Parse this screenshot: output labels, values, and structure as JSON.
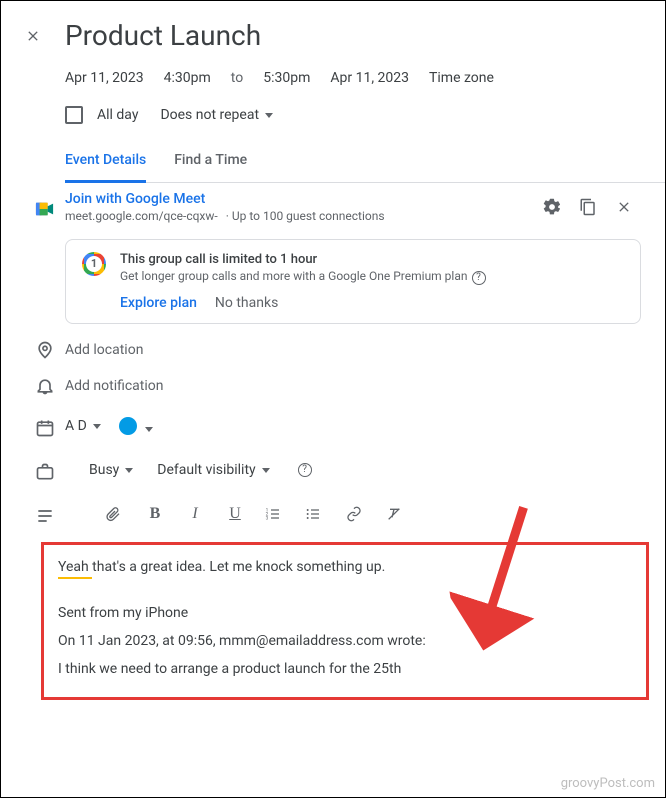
{
  "header": {
    "title": "Product Launch"
  },
  "datetime": {
    "start_date": "Apr 11, 2023",
    "start_time": "4:30pm",
    "to": "to",
    "end_time": "5:30pm",
    "end_date": "Apr 11, 2023",
    "timezone": "Time zone"
  },
  "all_day": {
    "label": "All day",
    "repeat": "Does not repeat"
  },
  "tabs": {
    "details": "Event Details",
    "find": "Find a Time"
  },
  "meet": {
    "title": "Join with Google Meet",
    "url": "meet.google.com/qce-cqxw-",
    "connections": "Up to 100 guest connections"
  },
  "promo": {
    "title": "This group call is limited to 1 hour",
    "sub": "Get longer group calls and more with a Google One Premium plan",
    "explore": "Explore plan",
    "nothanks": "No thanks"
  },
  "location": {
    "placeholder": "Add location"
  },
  "notification": {
    "placeholder": "Add notification"
  },
  "calendar": {
    "owner": "A D"
  },
  "availability": {
    "busy": "Busy",
    "visibility": "Default visibility"
  },
  "description": {
    "line1": "Yeah that's a great idea. Let me knock something up.",
    "line2": "Sent from my iPhone",
    "line3": "On 11 Jan 2023, at 09:56, mmm@emailaddress.com wrote:",
    "line4": "I think we need to arrange a product launch for the 25th"
  },
  "watermark": "groovyPost.com"
}
